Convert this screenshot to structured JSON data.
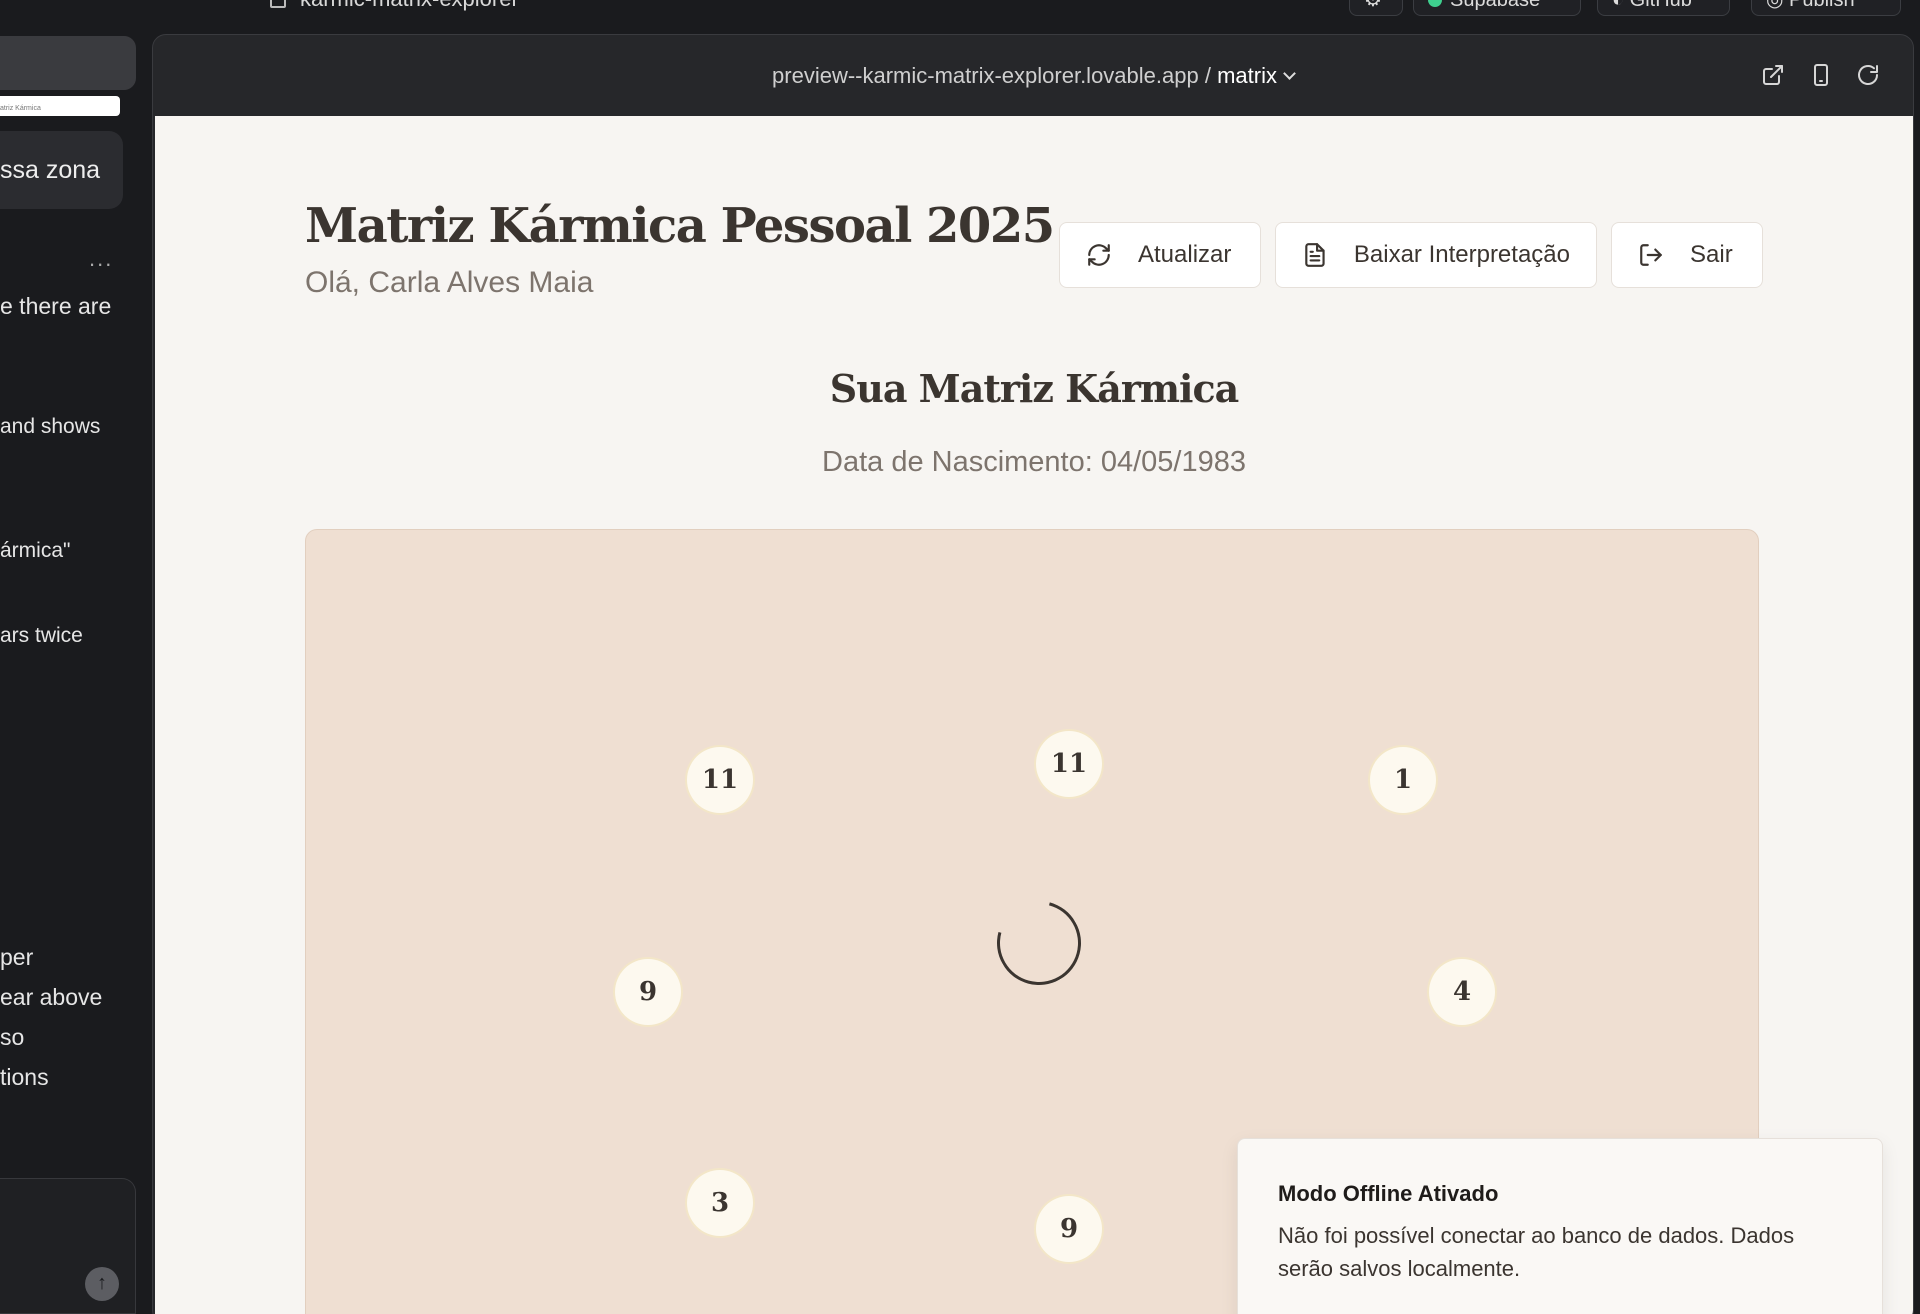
{
  "topbar": {
    "project_title": "karmic-matrix-explorer",
    "buttons": [
      "Supabase",
      "GitHub",
      "Publish"
    ]
  },
  "chat_panel": {
    "thumb_text": "atriz Kármica",
    "bubble_text": "ssa zona",
    "more": "...",
    "lines": [
      "e there are",
      "and shows",
      "ármica\"",
      "ars twice",
      "per",
      "ear above",
      "so",
      "tions"
    ]
  },
  "browser": {
    "url_host": "preview--karmic-matrix-explorer.lovable.app / ",
    "url_path": "matrix"
  },
  "header": {
    "title": "Matriz Kármica Pessoal 2025",
    "greeting": "Olá, Carla Alves Maia",
    "refresh_label": "Atualizar",
    "download_label": "Baixar Interpretação",
    "logout_label": "Sair"
  },
  "matrix": {
    "title": "Sua Matriz Kármica",
    "birth_date": "Data de Nascimento: 04/05/1983",
    "nodes": {
      "top_left": "11",
      "top_center": "11",
      "top_right": "1",
      "middle_left": "9",
      "middle_right": "4",
      "bottom_left": "3",
      "bottom_center": "9"
    }
  },
  "toast": {
    "title": "Modo Offline Ativado",
    "message": "Não foi possível conectar ao banco de dados. Dados serão salvos localmente."
  },
  "colors": {
    "page_bg": "#f7f5f2",
    "card_bg": "#efdfd2",
    "node_bg": "#fdf9ef",
    "text_dark": "#3b3530",
    "text_muted": "#7d746d",
    "chrome_dark": "#1a1b1e"
  }
}
